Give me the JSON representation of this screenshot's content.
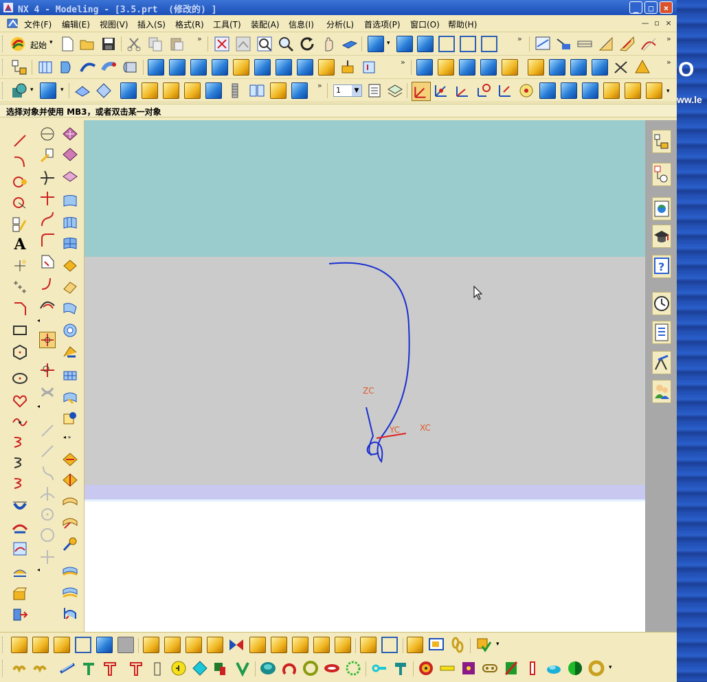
{
  "window": {
    "title": "NX 4 - Modeling - [3.5.prt  (修改的) ]",
    "minimize": "_",
    "maximize": "□",
    "close": "×"
  },
  "menu": {
    "items": [
      "文件(F)",
      "编辑(E)",
      "视图(V)",
      "插入(S)",
      "格式(R)",
      "工具(T)",
      "装配(A)",
      "信息(I)",
      "分析(L)",
      "首选项(P)",
      "窗口(O)",
      "帮助(H)"
    ],
    "mdi_buttons": [
      "—",
      "▫",
      "×"
    ]
  },
  "toolbar1": {
    "start_label": "起始",
    "layer_value": "1"
  },
  "status": {
    "prompt": "选择对象并使用 MB3，或者双击某一对象"
  },
  "viewport": {
    "axes": {
      "z": "ZC",
      "y": "YC",
      "x": "XC"
    },
    "curve_color": "#1a2fd0",
    "axis_label_color": "#e05a2a",
    "axis_line_color": "#e02020"
  },
  "background": {
    "text1": "O",
    "text2": "ww.le"
  },
  "icons": {
    "toolbar1": [
      "start-icon",
      "new-icon",
      "open-icon",
      "save-icon",
      "cut-icon",
      "copy-icon",
      "paste-icon",
      "fit-icon",
      "zoom-window-icon",
      "zoom-icon",
      "zoom-in-out-icon",
      "rotate-icon",
      "pan-icon",
      "perspective-icon",
      "shaded-icon",
      "view-top-icon",
      "view-front-icon",
      "view-right-icon",
      "view-iso-icon",
      "view-trimetric-icon",
      "section-icon",
      "measure-icon",
      "angle-icon",
      "sketch-icon",
      "grid-icon"
    ],
    "right_panel": [
      "assembly-navigator-icon",
      "part-navigator-icon",
      "web-browser-icon",
      "training-icon",
      "help-icon",
      "history-icon",
      "reuse-library-icon",
      "process-icon",
      "roles-icon"
    ]
  }
}
